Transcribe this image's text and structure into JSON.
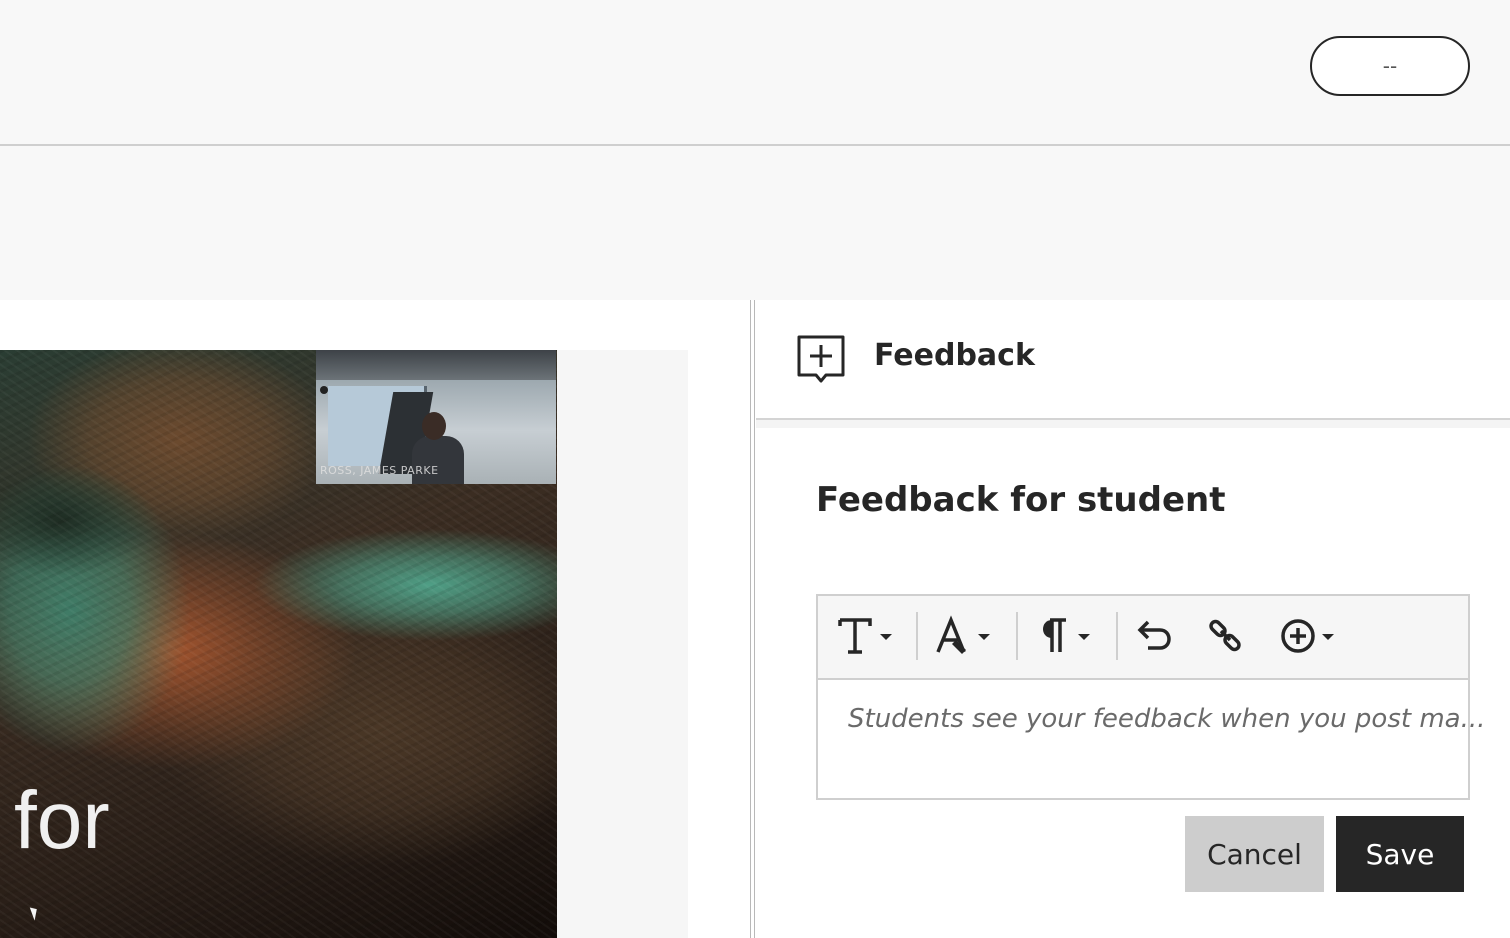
{
  "header": {
    "top_pill_value": "--",
    "second_pill_value": "--"
  },
  "video": {
    "caption": "for",
    "pip_name": "ROSS, JAMES PARKE"
  },
  "panel": {
    "title": "Feedback",
    "section_title": "Feedback for student",
    "editor": {
      "placeholder": "Students see your feedback when you post ma..."
    },
    "toolbar": [
      {
        "name": "text-style-icon",
        "has_dropdown": true
      },
      {
        "name": "text-format-icon",
        "has_dropdown": true
      },
      {
        "name": "paragraph-icon",
        "has_dropdown": true
      },
      {
        "name": "undo-icon",
        "has_dropdown": false
      },
      {
        "name": "link-icon",
        "has_dropdown": false
      },
      {
        "name": "insert-content-icon",
        "has_dropdown": true
      }
    ],
    "buttons": {
      "cancel_label": "Cancel",
      "save_label": "Save"
    }
  },
  "colors": {
    "primary_dark": "#262626",
    "secondary_button": "#cdcdcd",
    "bar_background": "#f8f8f8"
  }
}
